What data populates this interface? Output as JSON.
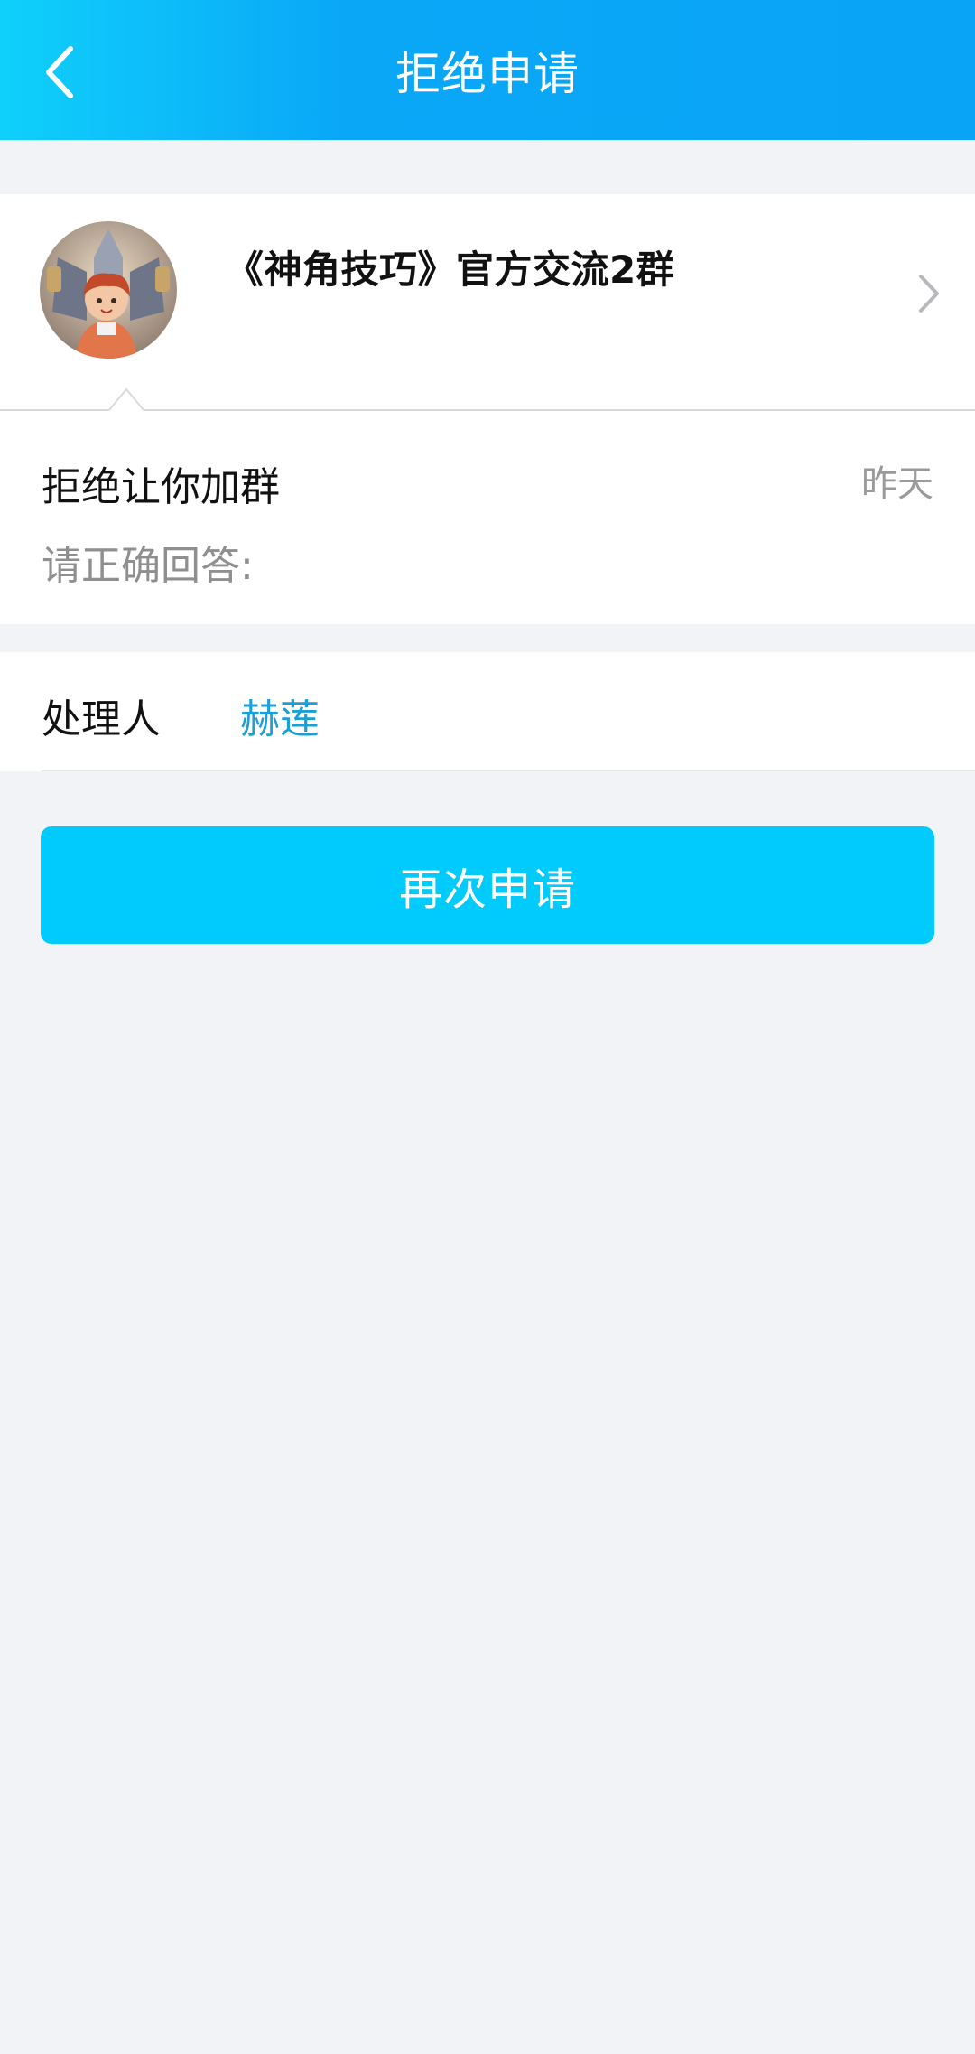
{
  "header": {
    "title": "拒绝申请",
    "back_icon": "chevron-left-icon"
  },
  "group": {
    "name": "《神角技巧》官方交流2群",
    "chevron_icon": "chevron-right-icon"
  },
  "rejection": {
    "message": "拒绝让你加群",
    "time": "昨天",
    "prompt": "请正确回答:"
  },
  "handler": {
    "label": "处理人",
    "name": "赫莲"
  },
  "actions": {
    "apply_again_label": "再次申请"
  },
  "colors": {
    "header_start": "#0fd0fb",
    "header_end": "#0aa4f6",
    "button": "#00cbfc",
    "link": "#1a9fd8",
    "background": "#f2f3f7"
  }
}
